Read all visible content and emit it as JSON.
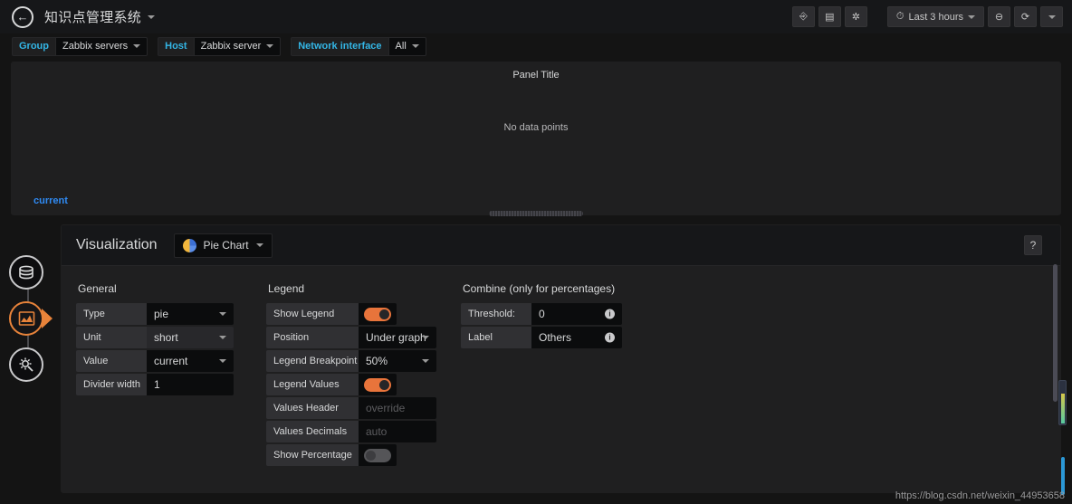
{
  "navbar": {
    "back_icon": "arrow-left-icon",
    "dashboard_title": "知识点管理系统",
    "buttons": [
      {
        "name": "share-dashboard",
        "icon": "share-icon",
        "glyph": "⎆"
      },
      {
        "name": "save-dashboard",
        "icon": "save-icon",
        "glyph": "▤"
      },
      {
        "name": "dashboard-settings",
        "icon": "gear-icon",
        "glyph": "✲"
      }
    ],
    "time_picker": {
      "icon": "clock-icon",
      "label": "Last 3 hours"
    },
    "zoom_out": {
      "icon": "search-minus-icon",
      "glyph": "⊖"
    },
    "refresh": {
      "icon": "refresh-icon",
      "glyph": "⟳"
    },
    "refresh_interval_caret": "caret-down-icon"
  },
  "submenu": {
    "variables": [
      {
        "label": "Group",
        "value": "Zabbix servers"
      },
      {
        "label": "Host",
        "value": "Zabbix server"
      },
      {
        "label": "Network interface",
        "value": "All"
      }
    ]
  },
  "panel": {
    "title": "Panel Title",
    "no_data": "No data points",
    "legend_item": "current"
  },
  "editor": {
    "heading": "Visualization",
    "viz_type": "Pie Chart",
    "viz_icon": "pie-chart-icon",
    "help_label": "?",
    "general": {
      "section_title": "General",
      "rows": [
        {
          "label": "Type",
          "value": "pie",
          "kind": "select"
        },
        {
          "label": "Unit",
          "value": "short",
          "kind": "select"
        },
        {
          "label": "Value",
          "value": "current",
          "kind": "select"
        },
        {
          "label": "Divider width",
          "value": "1",
          "kind": "text"
        }
      ]
    },
    "legend": {
      "section_title": "Legend",
      "show_legend": {
        "label": "Show Legend",
        "state": "on"
      },
      "position": {
        "label": "Position",
        "value": "Under graph"
      },
      "breakpoint": {
        "label": "Legend Breakpoint",
        "value": "50%"
      },
      "legend_values": {
        "label": "Legend Values",
        "state": "on"
      },
      "values_header": {
        "label": "Values Header",
        "placeholder": "override",
        "value": ""
      },
      "values_decimals": {
        "label": "Values Decimals",
        "placeholder": "auto",
        "value": ""
      },
      "show_percentage": {
        "label": "Show Percentage",
        "state": "off"
      }
    },
    "combine": {
      "section_title": "Combine (only for percentages)",
      "threshold": {
        "label": "Threshold:",
        "value": "0",
        "info": "info-icon"
      },
      "label_row": {
        "label": "Label",
        "value": "Others",
        "info": "info-icon"
      }
    }
  },
  "rail": {
    "items": [
      {
        "name": "queries-tab",
        "icon": "database-icon"
      },
      {
        "name": "visualization-tab",
        "icon": "chart-area-icon",
        "active": true
      },
      {
        "name": "general-tab",
        "icon": "gear-cog-icon"
      }
    ]
  },
  "watermark": {
    "text": "https://blog.csdn.net/weixin_44953658"
  },
  "colors": {
    "accent_orange": "#e8743b",
    "variable_blue": "#33b5e5",
    "legend_blue": "#2f8bf5",
    "panel_bg": "#1f1f20",
    "nav_bg": "#161719"
  }
}
